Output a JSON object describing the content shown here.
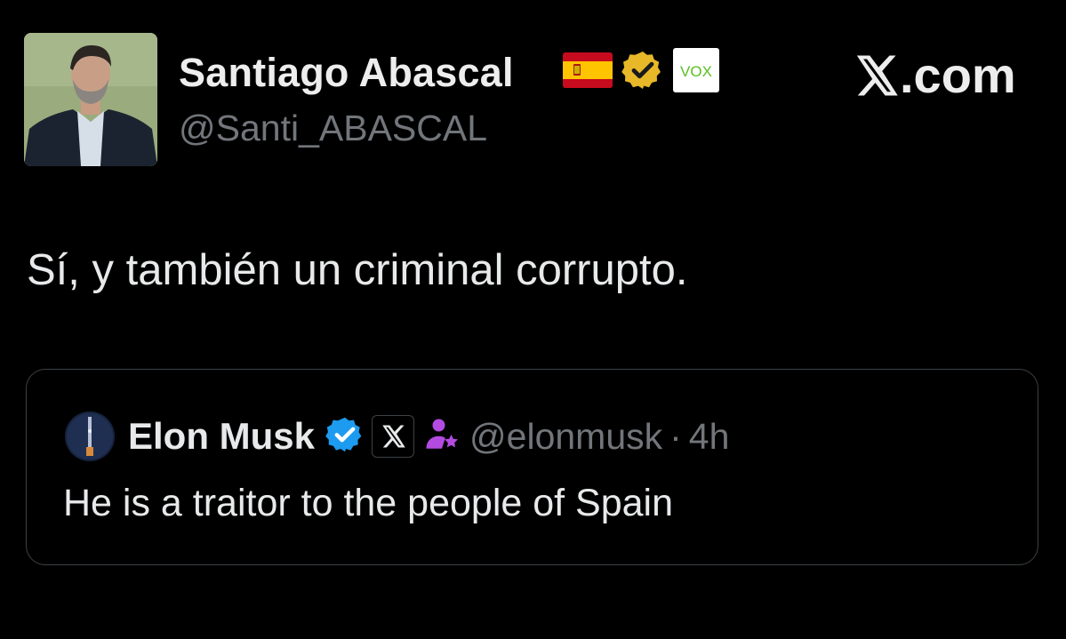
{
  "author": {
    "name": "Santiago Abascal",
    "handle": "@Santi_ABASCAL",
    "badges": [
      "spain-flag-icon",
      "verified-gold-badge-icon",
      "vox-logo"
    ],
    "vox_logo_text": "VOX"
  },
  "brand": {
    "label": ".com",
    "logo": "x-logo-icon"
  },
  "tweet": {
    "text": "Sí, y también un criminal corrupto."
  },
  "quoted_tweet": {
    "name": "Elon Musk",
    "handle": "@elonmusk",
    "separator": "·",
    "time": "4h",
    "text": "He is a traitor to the people of Spain",
    "badges": [
      "verified-blue-badge-icon",
      "x-affiliate-icon",
      "parody-person-icon"
    ]
  },
  "colors": {
    "background": "#000000",
    "text": "#e7e9ea",
    "muted": "#72767b",
    "border": "#3d4145",
    "verified_gold": "#e8b829",
    "verified_blue": "#1d9bf0",
    "vox_green": "#5bbf21",
    "parody_purple": "#b44be1"
  }
}
